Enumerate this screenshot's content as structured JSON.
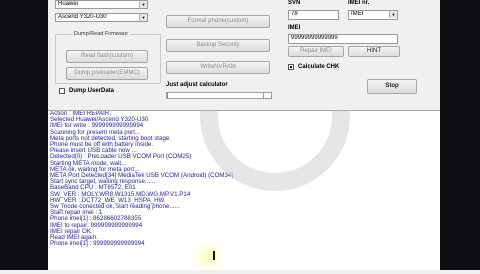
{
  "colors": {
    "log_text": "#25259b",
    "progress": "#56b24a",
    "background": "#f0f0f0",
    "dark_edge": "#0d0f12"
  },
  "left": {
    "brand": "Huawei",
    "model": "Ascend Y320-U30",
    "dump_group_title": "Dump/Read Firmware",
    "buttons": {
      "read_flash": "Read flash(custom)",
      "dump_preloader": "Dump preloader(EMMC)"
    },
    "dump_userdata": "Dump UserData"
  },
  "middle": {
    "buttons": {
      "format_phone": "Format phone(custom)",
      "backup_security": "Backup Security",
      "write_nvram": "WriteNVRAM"
    },
    "adjust_label": "Just adjust calculator",
    "progress_percent": 1
  },
  "right": {
    "svn_label": "SVN",
    "svn_value": "78",
    "imei_nr_label": "IMEI nr.",
    "imei_nr_value": "IMEI",
    "imei_label": "IMEI",
    "imei_value": "99999999999999",
    "repair_imei": "Repair IMEI",
    "hint": "HINT",
    "calculate_chk": "Calculate CHK",
    "stop": "Stop"
  },
  "log": [
    "Action : IMEI REPAIR.",
    "Selected Huawei/Ascend Y320-U30",
    "IMEI for write : 999999999999994",
    "Scanning for present meta port...",
    "Meta ports not detected, starting boot stage.",
    "Phone must be off with battery inside.",
    "Please insert USB cable now ...",
    "Detected(0) : PreLoader USB VCOM Port (COM25)",
    "Starting META mode, wait...",
    "META ok, waiting for meta port...",
    "META Port Detected[34] MediaTek USB VCOM (Android) (COM34)",
    "Start sync target, waiting response......",
    "BaseBand CPU : MT6572, E01",
    "SW_VER : MOLY.WR8.W1315.MD.WG.MP.V1.P14",
    "HW_VER : DCT72_WE_W13_HSPA_HW",
    "Sw_mode conected ok, start reading phone......",
    "Start repair imei : 1",
    "Phone imei[1] : 86286602788355",
    "IMEI to repair: 999999999999994",
    "IMEI repair OK.",
    "Read IMEI again.",
    "Phone imei[1] : 999999999999994"
  ]
}
